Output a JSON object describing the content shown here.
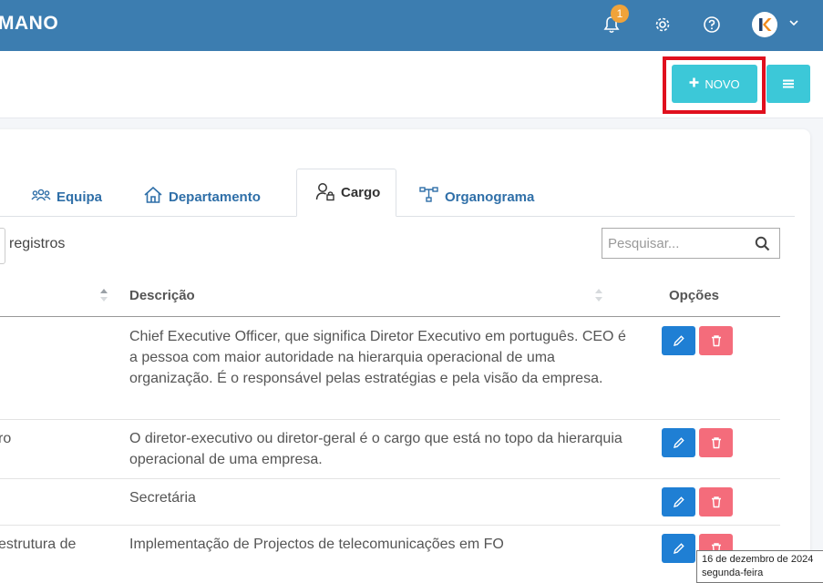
{
  "header": {
    "brand": "MANO",
    "notification_count": "1"
  },
  "toolbar": {
    "novo_label": "NOVO"
  },
  "tabs": [
    {
      "label": "Equipa",
      "icon": "team-icon"
    },
    {
      "label": "Departamento",
      "icon": "home-icon"
    },
    {
      "label": "Cargo",
      "icon": "user-lock-icon",
      "active": true
    },
    {
      "label": "Organograma",
      "icon": "org-chart-icon"
    }
  ],
  "list_controls": {
    "registros_label": "registros",
    "search_placeholder": "Pesquisar..."
  },
  "table": {
    "headers": {
      "descricao": "Descrição",
      "opcoes": "Opções"
    },
    "rows": [
      {
        "name": "",
        "description": "Chief Executive Officer, que significa Diretor Executivo em português. CEO é a pessoa com maior autoridade na hierarquia operacional de uma organização. É o responsável pelas estratégias e pela visão da empresa."
      },
      {
        "name": "ro",
        "description": "O diretor-executivo ou diretor-geral é o cargo que está no topo da hierarquia operacional de uma empresa."
      },
      {
        "name": "",
        "description": "Secretária"
      },
      {
        "name": "estrutura de",
        "description": "Implementação de Projectos de telecomunicações em FO"
      }
    ]
  },
  "tooltip": {
    "line1": "16 de dezembro de 2024",
    "line2": "segunda-feira"
  },
  "colors": {
    "topbar": "#3c7db0",
    "accent": "#3cc8d8",
    "edit": "#1f7fd4",
    "delete": "#f46c7b",
    "highlight": "#e0101e"
  }
}
